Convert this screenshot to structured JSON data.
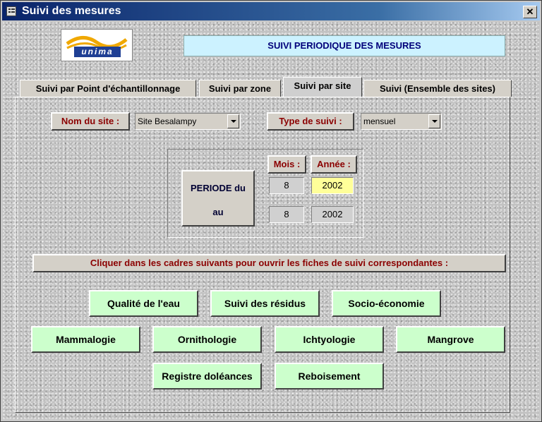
{
  "window": {
    "title": "Suivi des mesures",
    "close_label": "✕"
  },
  "logo": {
    "text": "unima"
  },
  "header": {
    "title": "SUIVI PERIODIQUE DES MESURES"
  },
  "tabs": [
    {
      "label": "Suivi par Point d'échantillonnage",
      "active": false
    },
    {
      "label": "Suivi par zone",
      "active": false
    },
    {
      "label": "Suivi par site",
      "active": true
    },
    {
      "label": "Suivi (Ensemble des sites)",
      "active": false
    }
  ],
  "filters": {
    "site_label": "Nom du site :",
    "site_value": "Site Besalampy",
    "type_label": "Type de suivi :",
    "type_value": "mensuel"
  },
  "period": {
    "button_line1": "PERIODE du",
    "button_line2": "au",
    "mois_label": "Mois :",
    "annee_label": "Année :",
    "from_month": "8",
    "from_year": "2002",
    "to_month": "8",
    "to_year": "2002"
  },
  "instruction": "Cliquer dans les cadres suivants pour ouvrir les fiches de suivi correspondantes :",
  "modules": {
    "qualite": "Qualité de l'eau",
    "residus": "Suivi des résidus",
    "socio": "Socio-économie",
    "mammalogie": "Mammalogie",
    "ornithologie": "Ornithologie",
    "ichtyologie": "Ichtyologie",
    "mangrove": "Mangrove",
    "doleances": "Registre doléances",
    "reboisement": "Reboisement"
  },
  "colors": {
    "titlebar": "#0a246a",
    "header_bg": "#ccf2ff",
    "module_bg": "#ccffcc",
    "label_red": "#8b0000",
    "highlight_field": "#ffff99"
  }
}
